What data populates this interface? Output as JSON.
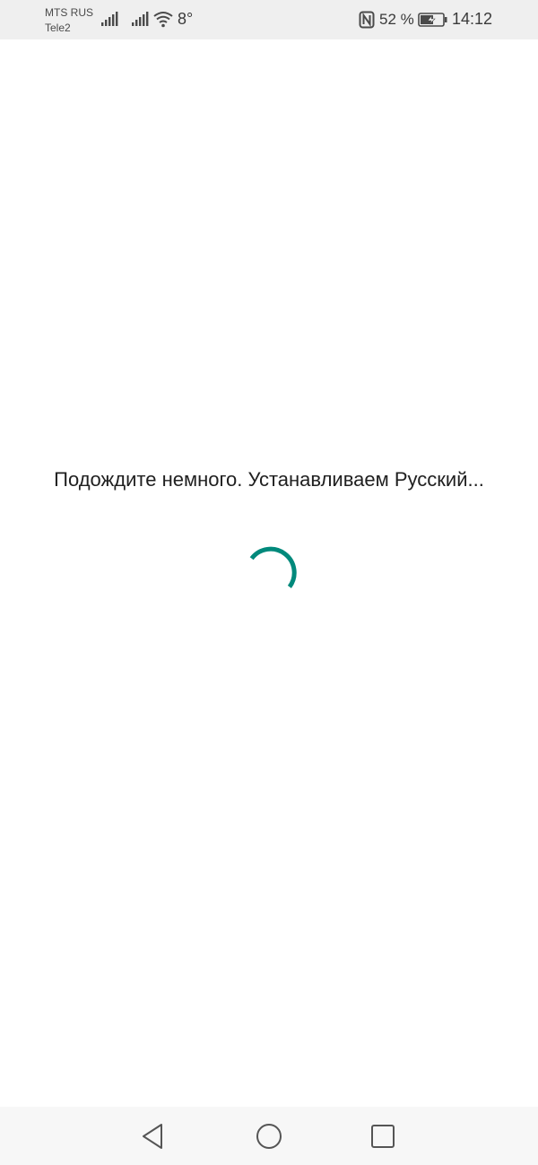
{
  "status_bar": {
    "carrier_1": "MTS RUS",
    "carrier_2": "Tele2",
    "temperature": "8°",
    "battery_percent": "52 %",
    "time": "14:12",
    "icons": [
      "signal-icon",
      "signal-icon",
      "wifi-icon",
      "nfc-icon",
      "battery-charging-icon"
    ]
  },
  "main": {
    "loading_message": "Подождите немного. Устанавливаем Русский...",
    "spinner_color": "#00897b"
  },
  "nav_bar": {
    "buttons": [
      "back-icon",
      "home-icon",
      "recent-apps-icon"
    ]
  }
}
